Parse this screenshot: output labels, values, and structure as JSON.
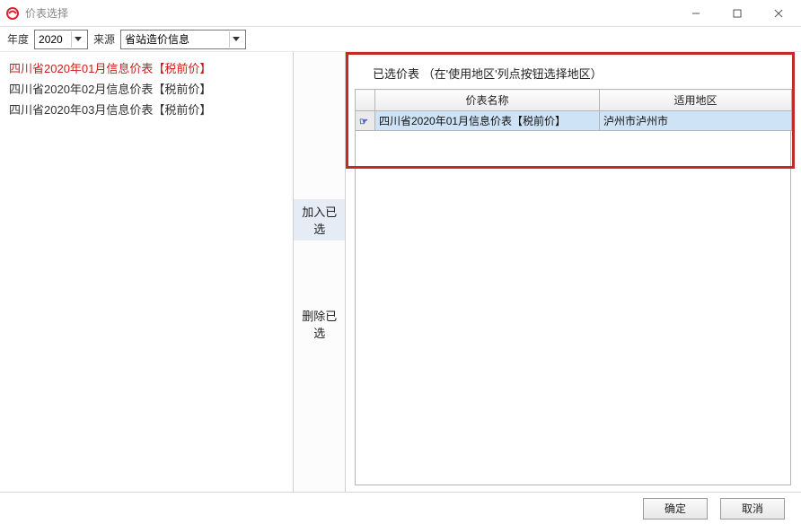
{
  "window": {
    "title": "价表选择"
  },
  "filter": {
    "year_label": "年度",
    "year_value": "2020",
    "source_label": "来源",
    "source_value": "省站造价信息"
  },
  "left_list": {
    "items": [
      {
        "label": "四川省2020年01月信息价表【税前价】",
        "selected": true
      },
      {
        "label": "四川省2020年02月信息价表【税前价】",
        "selected": false
      },
      {
        "label": "四川省2020年03月信息价表【税前价】",
        "selected": false
      }
    ]
  },
  "middle": {
    "add_label": "加入已选",
    "remove_label": "删除已选"
  },
  "selected_panel": {
    "title": "已选价表 （在'使用地区'列点按钮选择地区）",
    "columns": {
      "name": "价表名称",
      "region": "适用地区"
    },
    "rows": [
      {
        "name": "四川省2020年01月信息价表【税前价】",
        "region": "泸州市泸州市"
      }
    ]
  },
  "footer": {
    "ok": "确定",
    "cancel": "取消"
  }
}
